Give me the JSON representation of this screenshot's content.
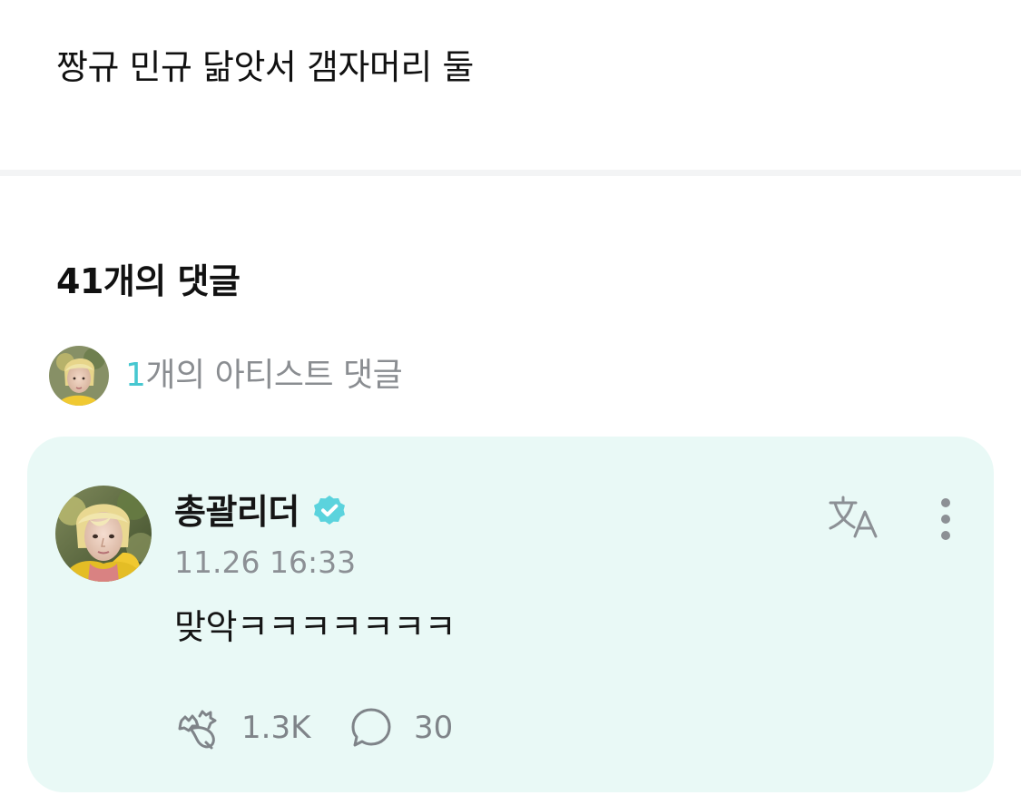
{
  "post": {
    "text": "짱규 민규 닮앗서 갬자머리 둘"
  },
  "comments": {
    "heading": "41개의 댓글",
    "artist_summary": {
      "count": "1",
      "label": "개의 아티스트 댓글"
    },
    "card": {
      "author": "총괄리더",
      "timestamp": "11.26 16:33",
      "text": "맞악ㅋㅋㅋㅋㅋㅋㅋ",
      "likes": "1.3K",
      "replies": "30",
      "icons": {
        "avatar": "artist-avatar",
        "verified": "verified-badge-icon",
        "translate": "translate-icon",
        "more": "more-vertical-icon",
        "like": "sparkle-like-icon",
        "reply": "speech-bubble-icon"
      }
    }
  },
  "colors": {
    "accent": "#46c7d0",
    "card_background": "#e9f9f6",
    "muted_text": "#8c9095"
  }
}
